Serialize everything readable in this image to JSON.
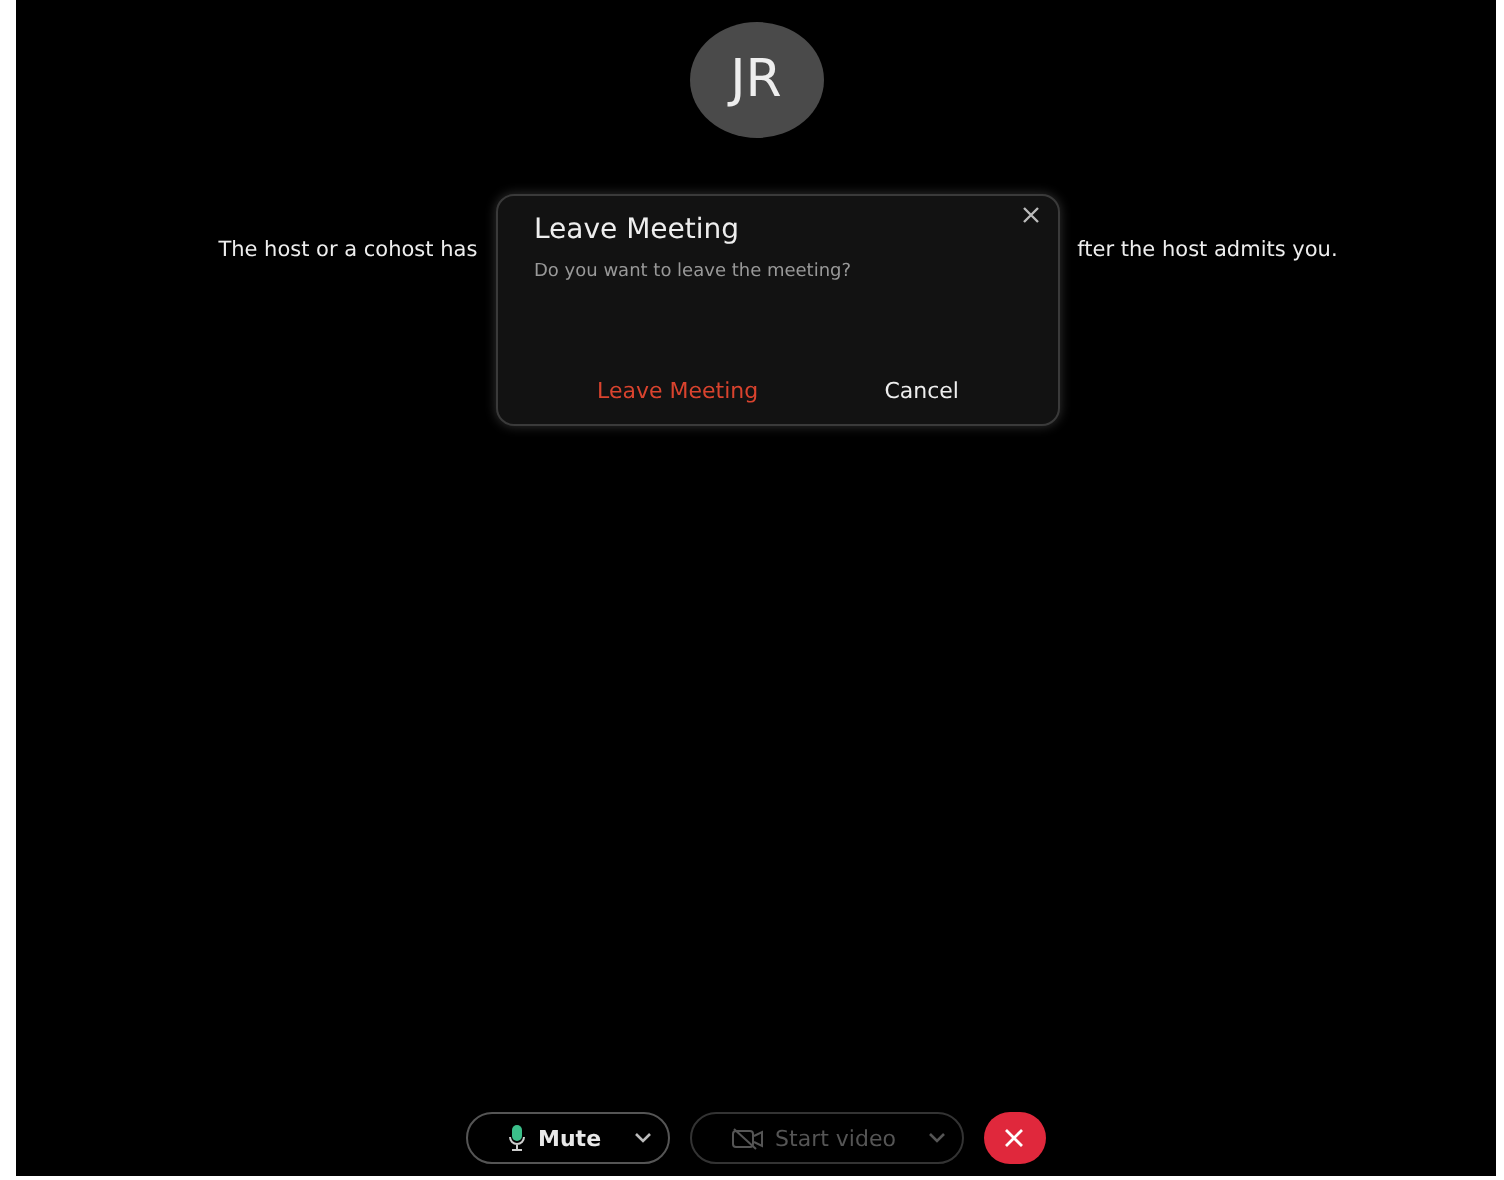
{
  "avatar": {
    "initials": "JR"
  },
  "waiting_message": {
    "left_part": "The host or a cohost has",
    "right_part": "fter the host admits you."
  },
  "dialog": {
    "title": "Leave Meeting",
    "message": "Do you want to leave the meeting?",
    "buttons": [
      {
        "label": "Leave Meeting",
        "kind": "danger"
      },
      {
        "label": "Cancel",
        "kind": "plain"
      }
    ]
  },
  "toolbar": {
    "mute": {
      "label": "Mute",
      "disabled": false
    },
    "video": {
      "label": "Start video",
      "disabled": true
    }
  }
}
